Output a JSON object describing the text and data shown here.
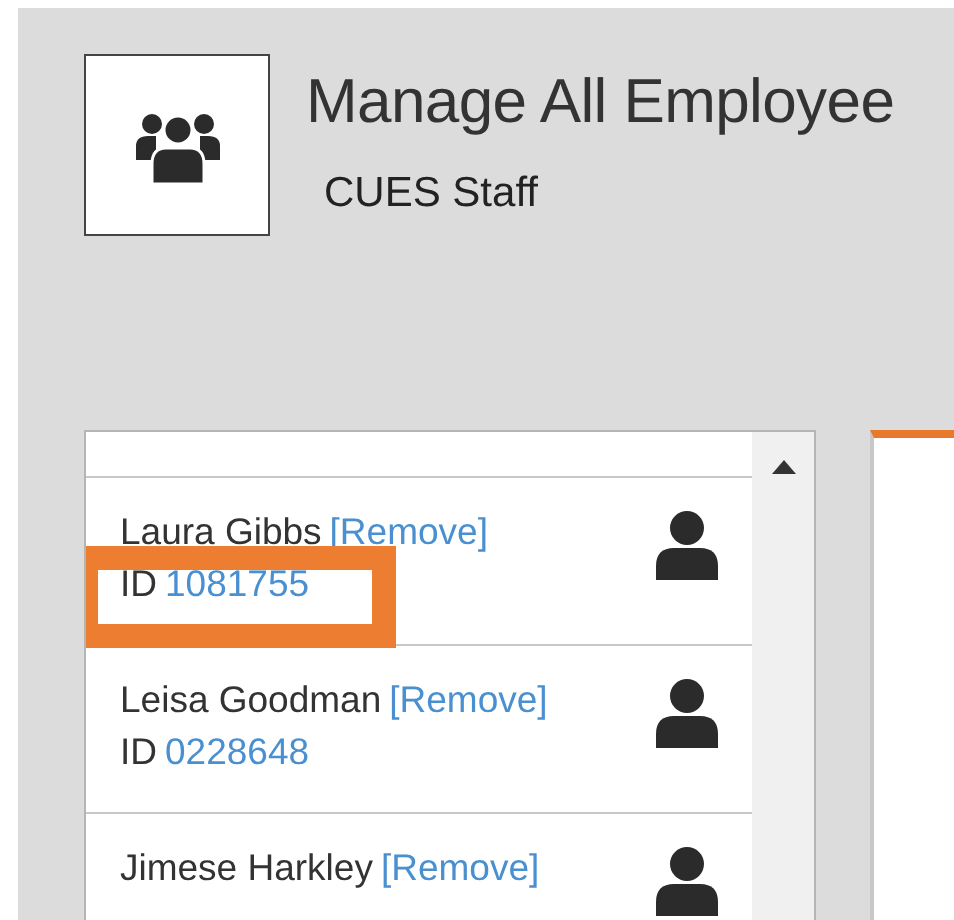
{
  "header": {
    "title": "Manage All Employee",
    "subtitle": "CUES Staff"
  },
  "employees": [
    {
      "name": "Laura Gibbs",
      "action": "[Remove]",
      "id_label": "ID",
      "id": "1081755",
      "highlighted": true
    },
    {
      "name": "Leisa Goodman",
      "action": "[Remove]",
      "id_label": "ID",
      "id": "0228648",
      "highlighted": false
    },
    {
      "name": "Jimese Harkley",
      "action": "[Remove]",
      "highlighted": false
    }
  ]
}
